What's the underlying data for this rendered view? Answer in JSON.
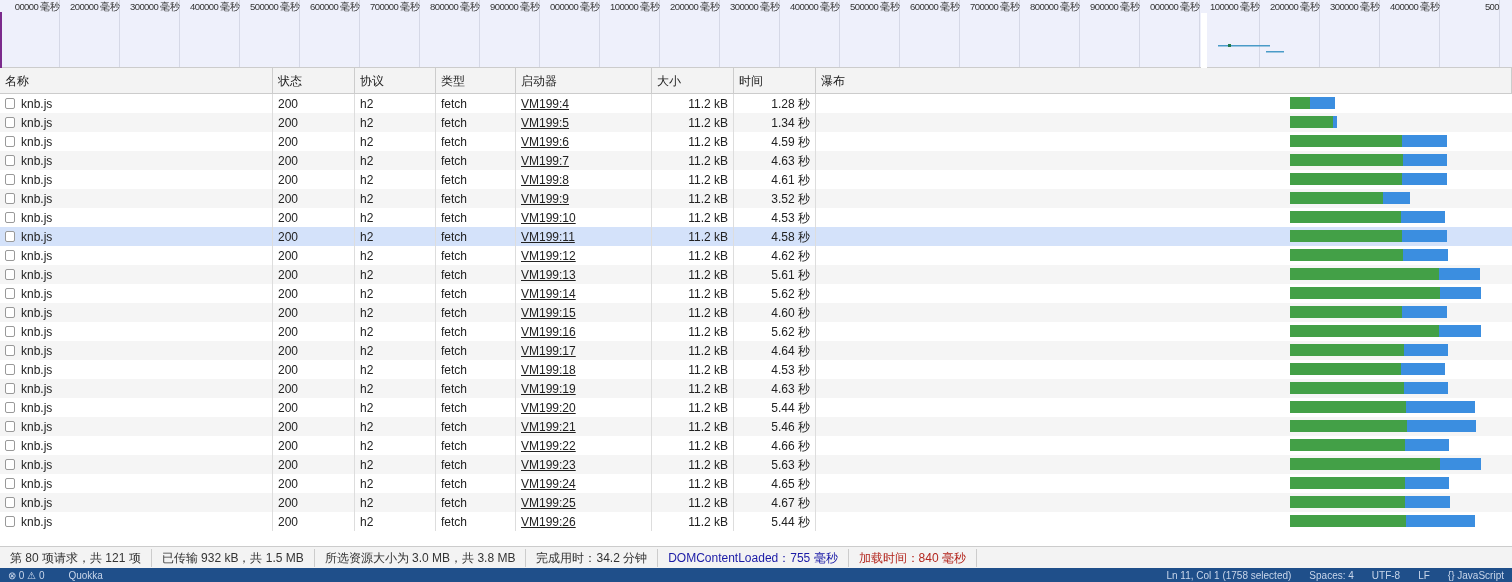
{
  "overview": {
    "labels": [
      "00000 毫秒",
      "200000 毫秒",
      "300000 毫秒",
      "400000 毫秒",
      "500000 毫秒",
      "600000 毫秒",
      "700000 毫秒",
      "800000 毫秒",
      "900000 毫秒",
      "000000 毫秒",
      "100000 毫秒",
      "200000 毫秒",
      "300000 毫秒",
      "400000 毫秒",
      "500000 毫秒",
      "600000 毫秒",
      "700000 毫秒",
      "800000 毫秒",
      "900000 毫秒",
      "000000 毫秒",
      "100000 毫秒",
      "200000 毫秒",
      "300000 毫秒",
      "400000 毫秒",
      "500"
    ]
  },
  "table": {
    "columns": [
      "名称",
      "状态",
      "协议",
      "类型",
      "启动器",
      "大小",
      "时间",
      "瀑布"
    ],
    "rows": [
      {
        "name": "knb.js",
        "status": "200",
        "protocol": "h2",
        "type": "fetch",
        "initiator": "VM199:4",
        "size": "11.2 kB",
        "time": "1.28 秒",
        "checked": false,
        "selected": false
      },
      {
        "name": "knb.js",
        "status": "200",
        "protocol": "h2",
        "type": "fetch",
        "initiator": "VM199:5",
        "size": "11.2 kB",
        "time": "1.34 秒",
        "checked": false,
        "selected": false
      },
      {
        "name": "knb.js",
        "status": "200",
        "protocol": "h2",
        "type": "fetch",
        "initiator": "VM199:6",
        "size": "11.2 kB",
        "time": "4.59 秒",
        "checked": false,
        "selected": false
      },
      {
        "name": "knb.js",
        "status": "200",
        "protocol": "h2",
        "type": "fetch",
        "initiator": "VM199:7",
        "size": "11.2 kB",
        "time": "4.63 秒",
        "checked": false,
        "selected": false
      },
      {
        "name": "knb.js",
        "status": "200",
        "protocol": "h2",
        "type": "fetch",
        "initiator": "VM199:8",
        "size": "11.2 kB",
        "time": "4.61 秒",
        "checked": false,
        "selected": false
      },
      {
        "name": "knb.js",
        "status": "200",
        "protocol": "h2",
        "type": "fetch",
        "initiator": "VM199:9",
        "size": "11.2 kB",
        "time": "3.52 秒",
        "checked": false,
        "selected": false
      },
      {
        "name": "knb.js",
        "status": "200",
        "protocol": "h2",
        "type": "fetch",
        "initiator": "VM199:10",
        "size": "11.2 kB",
        "time": "4.53 秒",
        "checked": false,
        "selected": false
      },
      {
        "name": "knb.js",
        "status": "200",
        "protocol": "h2",
        "type": "fetch",
        "initiator": "VM199:11",
        "size": "11.2 kB",
        "time": "4.58 秒",
        "checked": false,
        "selected": true
      },
      {
        "name": "knb.js",
        "status": "200",
        "protocol": "h2",
        "type": "fetch",
        "initiator": "VM199:12",
        "size": "11.2 kB",
        "time": "4.62 秒",
        "checked": false,
        "selected": false
      },
      {
        "name": "knb.js",
        "status": "200",
        "protocol": "h2",
        "type": "fetch",
        "initiator": "VM199:13",
        "size": "11.2 kB",
        "time": "5.61 秒",
        "checked": false,
        "selected": false
      },
      {
        "name": "knb.js",
        "status": "200",
        "protocol": "h2",
        "type": "fetch",
        "initiator": "VM199:14",
        "size": "11.2 kB",
        "time": "5.62 秒",
        "checked": false,
        "selected": false
      },
      {
        "name": "knb.js",
        "status": "200",
        "protocol": "h2",
        "type": "fetch",
        "initiator": "VM199:15",
        "size": "11.2 kB",
        "time": "4.60 秒",
        "checked": false,
        "selected": false
      },
      {
        "name": "knb.js",
        "status": "200",
        "protocol": "h2",
        "type": "fetch",
        "initiator": "VM199:16",
        "size": "11.2 kB",
        "time": "5.62 秒",
        "checked": false,
        "selected": false
      },
      {
        "name": "knb.js",
        "status": "200",
        "protocol": "h2",
        "type": "fetch",
        "initiator": "VM199:17",
        "size": "11.2 kB",
        "time": "4.64 秒",
        "checked": false,
        "selected": false
      },
      {
        "name": "knb.js",
        "status": "200",
        "protocol": "h2",
        "type": "fetch",
        "initiator": "VM199:18",
        "size": "11.2 kB",
        "time": "4.53 秒",
        "checked": false,
        "selected": false
      },
      {
        "name": "knb.js",
        "status": "200",
        "protocol": "h2",
        "type": "fetch",
        "initiator": "VM199:19",
        "size": "11.2 kB",
        "time": "4.63 秒",
        "checked": false,
        "selected": false
      },
      {
        "name": "knb.js",
        "status": "200",
        "protocol": "h2",
        "type": "fetch",
        "initiator": "VM199:20",
        "size": "11.2 kB",
        "time": "5.44 秒",
        "checked": false,
        "selected": false
      },
      {
        "name": "knb.js",
        "status": "200",
        "protocol": "h2",
        "type": "fetch",
        "initiator": "VM199:21",
        "size": "11.2 kB",
        "time": "5.46 秒",
        "checked": false,
        "selected": false
      },
      {
        "name": "knb.js",
        "status": "200",
        "protocol": "h2",
        "type": "fetch",
        "initiator": "VM199:22",
        "size": "11.2 kB",
        "time": "4.66 秒",
        "checked": false,
        "selected": false
      },
      {
        "name": "knb.js",
        "status": "200",
        "protocol": "h2",
        "type": "fetch",
        "initiator": "VM199:23",
        "size": "11.2 kB",
        "time": "5.63 秒",
        "checked": false,
        "selected": false
      },
      {
        "name": "knb.js",
        "status": "200",
        "protocol": "h2",
        "type": "fetch",
        "initiator": "VM199:24",
        "size": "11.2 kB",
        "time": "4.65 秒",
        "checked": false,
        "selected": false
      },
      {
        "name": "knb.js",
        "status": "200",
        "protocol": "h2",
        "type": "fetch",
        "initiator": "VM199:25",
        "size": "11.2 kB",
        "time": "4.67 秒",
        "checked": false,
        "selected": false
      },
      {
        "name": "knb.js",
        "status": "200",
        "protocol": "h2",
        "type": "fetch",
        "initiator": "VM199:26",
        "size": "11.2 kB",
        "time": "5.44 秒",
        "checked": false,
        "selected": false
      }
    ]
  },
  "summary": [
    {
      "kind": "plain",
      "text": "第 80 项请求，共 121 项"
    },
    {
      "kind": "plain",
      "text": "已传输 932 kB，共 1.5 MB"
    },
    {
      "kind": "plain",
      "text": "所选资源大小为 3.0 MB，共 3.8 MB"
    },
    {
      "kind": "plain",
      "text": "完成用时：34.2 分钟"
    },
    {
      "kind": "domcontent",
      "text": "DOMContentLoaded：755 毫秒"
    },
    {
      "kind": "load",
      "text": "加载时间：840 毫秒"
    }
  ],
  "editor_status": {
    "error_icon": "⊗",
    "warning_icon": "⚠",
    "errors": "0",
    "warnings": "0",
    "left": [
      "Quokka"
    ],
    "right": [
      "Ln 11, Col 1 (1758 selected)",
      "Spaces: 4",
      "UTF-8",
      "LF",
      "{} JavaScript"
    ]
  }
}
